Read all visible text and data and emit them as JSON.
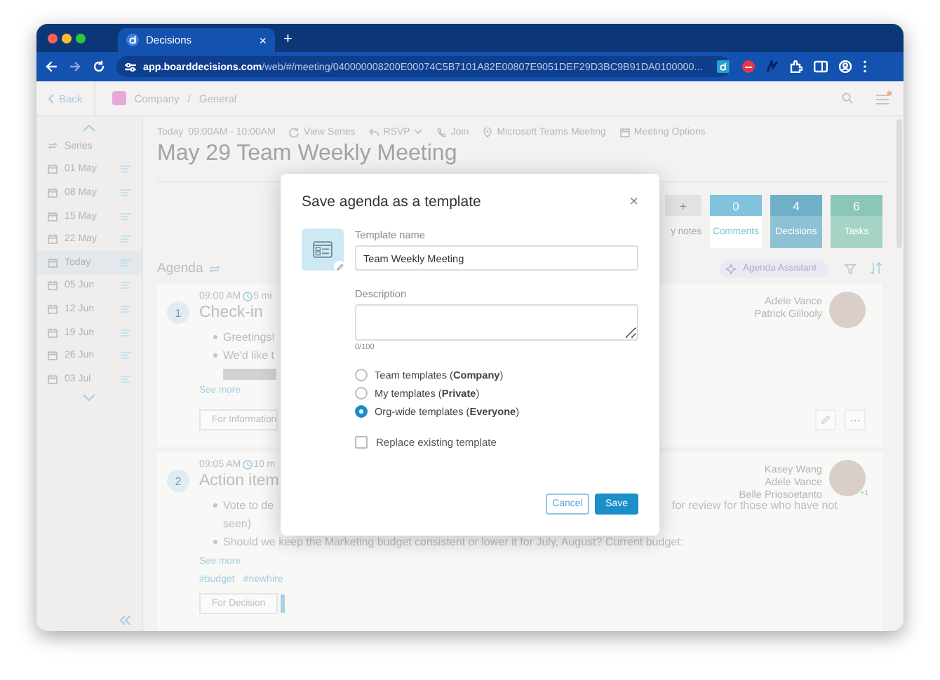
{
  "browser": {
    "tab": {
      "title": "Decisions",
      "close": "×"
    },
    "new_tab": "+",
    "url": {
      "host": "app.boarddecisions.com",
      "path": "/web/#/meeting/040000008200E00074C5B7101A82E00807E9051DEF29D3BC9B91DA0100000..."
    }
  },
  "topbar": {
    "back": "Back",
    "breadcrumbs": [
      "Company",
      "General"
    ],
    "separator": "/"
  },
  "sidebar": {
    "series": "Series",
    "items": [
      {
        "label": "01 May",
        "selected": false
      },
      {
        "label": "08 May",
        "selected": false
      },
      {
        "label": "15 May",
        "selected": false
      },
      {
        "label": "22 May",
        "selected": false
      },
      {
        "label": "Today",
        "selected": true
      },
      {
        "label": "05 Jun",
        "selected": false
      },
      {
        "label": "12 Jun",
        "selected": false
      },
      {
        "label": "19 Jun",
        "selected": false
      },
      {
        "label": "26 Jun",
        "selected": false
      },
      {
        "label": "03 Jul",
        "selected": false
      }
    ]
  },
  "meeting": {
    "date": "Today",
    "time": "09:00AM - 10:00AM",
    "actions": [
      {
        "kind": "series",
        "label": "View Series"
      },
      {
        "kind": "rsvp",
        "label": "RSVP"
      },
      {
        "kind": "join",
        "label": "Join"
      },
      {
        "kind": "location",
        "label": "Microsoft Teams Meeting"
      },
      {
        "kind": "options",
        "label": "Meeting Options"
      }
    ],
    "title": "May 29 Team Weekly Meeting"
  },
  "stats": [
    {
      "kind": "add",
      "value": "+",
      "label": "y notes",
      "color": "#e2e2e1"
    },
    {
      "kind": "outline",
      "value": "0",
      "label": "Comments",
      "color": "#7fc3dc"
    },
    {
      "kind": "filled",
      "value": "4",
      "label": "Decisions",
      "color": "#6fb0c9"
    },
    {
      "kind": "filled",
      "value": "6",
      "label": "Tasks",
      "color": "#8cc6b6"
    }
  ],
  "agenda": {
    "title": "Agenda",
    "assistant": "Agenda Assistant",
    "items": [
      {
        "number": "1",
        "time": "09:00 AM",
        "duration": "5 mi",
        "title": "Check-in",
        "presenters": [
          "Adele Vance",
          "Patrick Gillooly"
        ],
        "lines": [
          {
            "kind": "bullet",
            "text": "Greetings!"
          },
          {
            "kind": "bullet",
            "text": "We'd like t"
          },
          {
            "kind": "image"
          }
        ],
        "see_more": "See more",
        "tag": "For Information"
      },
      {
        "number": "2",
        "time": "09:05 AM",
        "duration": "10 m",
        "title": "Action item",
        "presenters": [
          "Kasey Wang",
          "Adele Vance",
          "Belle Priosoetanto"
        ],
        "avatar_badge": "+1",
        "lines": [
          {
            "kind": "bullet",
            "text": "Vote to de",
            "tail": "for review for those who have not"
          },
          {
            "kind": "continuation",
            "text": "seen)"
          },
          {
            "kind": "bullet",
            "text": "Should we keep the Marketing budget consistent or lower it for July, August? Current budget:"
          }
        ],
        "see_more": "See more",
        "hashtags": [
          "#budget",
          "#newhire"
        ],
        "tag": "For Decision"
      }
    ]
  },
  "dialog": {
    "title": "Save agenda as a template",
    "close": "×",
    "name_label": "Template name",
    "name_value": "Team Weekly Meeting",
    "description_label": "Description",
    "counter": "0/100",
    "scopes": [
      {
        "label": "Team templates (**Company**)",
        "selected": false
      },
      {
        "label": "My templates (**Private**)",
        "selected": false
      },
      {
        "label": "Org-wide templates (**Everyone**)",
        "selected": true
      }
    ],
    "replace": {
      "label": "Replace existing template",
      "checked": false
    },
    "buttons": [
      {
        "kind": "secondary",
        "label": "Cancel"
      },
      {
        "kind": "primary",
        "label": "Save"
      }
    ]
  }
}
